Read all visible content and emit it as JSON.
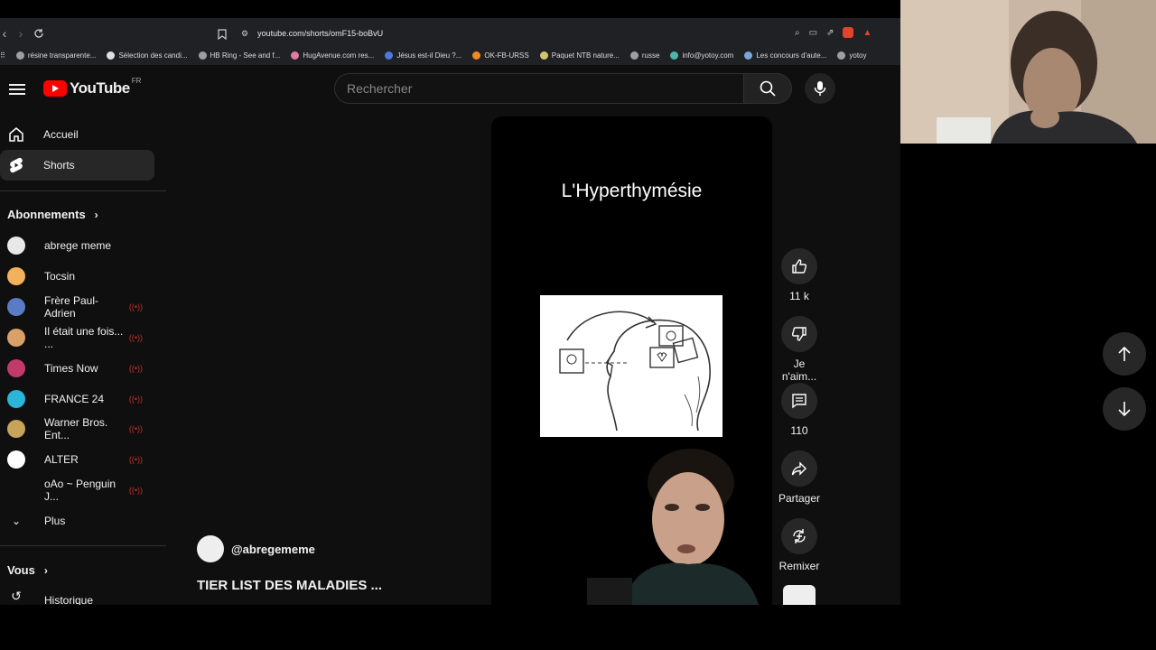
{
  "browser": {
    "url": "youtube.com/shorts/omF15-boBvU",
    "bookmarks": [
      {
        "label": "résine transparente...",
        "color": "#9aa0a6"
      },
      {
        "label": "Sélection des candi...",
        "color": "#e0e0e0"
      },
      {
        "label": "HB Ring - See and f...",
        "color": "#9aa0a6"
      },
      {
        "label": "HugAvenue.com res...",
        "color": "#e07aa0"
      },
      {
        "label": "Jésus est-il Dieu ?...",
        "color": "#4a7bd8"
      },
      {
        "label": "OK-FB-URSS",
        "color": "#f08a24"
      },
      {
        "label": "Paquet NTB nature...",
        "color": "#d4c56a"
      },
      {
        "label": "russe",
        "color": "#9aa0a6"
      },
      {
        "label": "info@yotoy.com",
        "color": "#4db6ac"
      },
      {
        "label": "Les concours d'aute...",
        "color": "#7aa7d8"
      },
      {
        "label": "yotoy",
        "color": "#9aa0a6"
      }
    ]
  },
  "header": {
    "logo_text": "YouTube",
    "country": "FR",
    "search_placeholder": "Rechercher"
  },
  "sidebar": {
    "nav": [
      {
        "label": "Accueil",
        "icon": "home-icon"
      },
      {
        "label": "Shorts",
        "icon": "shorts-icon"
      }
    ],
    "subscriptions_title": "Abonnements",
    "subscriptions": [
      {
        "label": "abrege meme",
        "color": "#e8e8e8",
        "live": false
      },
      {
        "label": "Tocsin",
        "color": "#f2b25c",
        "live": false
      },
      {
        "label": "Frère Paul-Adrien",
        "color": "#5a7cc4",
        "live": true
      },
      {
        "label": "Il était une fois... ...",
        "color": "#d9a06a",
        "live": true
      },
      {
        "label": "Times Now",
        "color": "#c23a6a",
        "live": true
      },
      {
        "label": "FRANCE 24",
        "color": "#2bb5d9",
        "live": true
      },
      {
        "label": "Warner Bros. Ent...",
        "color": "#c7a45a",
        "live": true
      },
      {
        "label": "ALTER",
        "color": "#ffffff",
        "live": true
      },
      {
        "label": "oAo ~ Penguin J...",
        "color": "#0f0f0f",
        "live": true
      }
    ],
    "more_label": "Plus",
    "you_title": "Vous",
    "history_label": "Historique"
  },
  "short": {
    "overlay_title": "L'Hyperthymésie",
    "channel": "@abregememe",
    "title": "TIER LIST DES MALADIES ...",
    "actions": {
      "like_count": "11 k",
      "dislike_label": "Je n'aim...",
      "comment_count": "110",
      "share_label": "Partager",
      "remix_label": "Remixer"
    }
  }
}
